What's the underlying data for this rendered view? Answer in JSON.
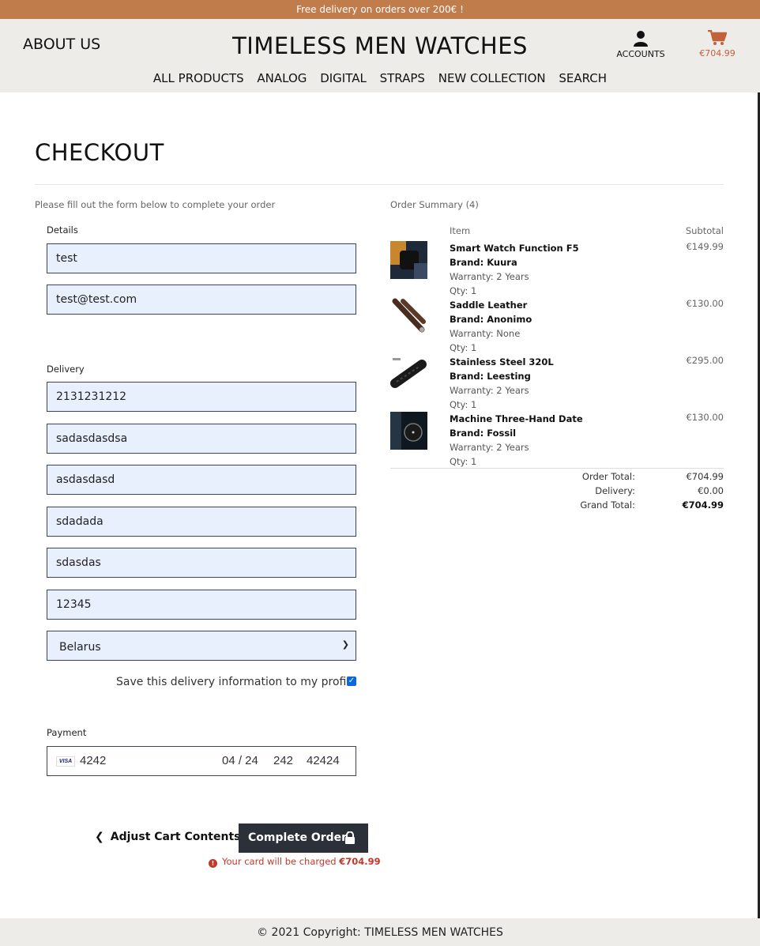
{
  "banner": {
    "text": "Free delivery on orders over 200€ !"
  },
  "header": {
    "about": "ABOUT US",
    "brand": "TIMELESS MEN WATCHES",
    "accounts_label": "ACCOUNTS",
    "cart_total": "€704.99"
  },
  "nav": {
    "items": [
      "ALL PRODUCTS",
      "ANALOG",
      "DIGITAL",
      "STRAPS",
      "NEW COLLECTION",
      "SEARCH"
    ]
  },
  "page": {
    "title": "CHECKOUT"
  },
  "form": {
    "intro": "Please fill out the form below to complete your order",
    "details_label": "Details",
    "full_name": "test",
    "email": "test@test.com",
    "delivery_label": "Delivery",
    "phone": "2131231212",
    "street1": "sadasdasdsa",
    "street2": "asdasdasd",
    "town": "sdadada",
    "county": "sdasdas",
    "postcode": "12345",
    "country": "Belarus",
    "save_info": "Save this delivery information to my profile",
    "save_checked": true,
    "payment_label": "Payment",
    "card": {
      "brand": "VISA",
      "number": "4242",
      "expiry": "04 / 24",
      "cvc": "242",
      "zip": "42424"
    },
    "adjust_label": "Adjust Cart Contents",
    "complete_label": "Complete Order",
    "charge_text": "Your card will be charged",
    "charge_amount": "€704.99"
  },
  "summary": {
    "title": "Order Summary (4)",
    "col_item": "Item",
    "col_subtotal": "Subtotal",
    "items": [
      {
        "name": "Smart Watch Function F5",
        "brand": "Brand: Kuura",
        "warranty": "Warranty: 2 Years",
        "qty": "Qty: 1",
        "price": "€149.99"
      },
      {
        "name": "Saddle Leather",
        "brand": "Brand: Anonimo",
        "warranty": "Warranty: None",
        "qty": "Qty: 1",
        "price": "€130.00"
      },
      {
        "name": "Stainless Steel 320L",
        "brand": "Brand: Leesting",
        "warranty": "Warranty: 2 Years",
        "qty": "Qty: 1",
        "price": "€295.00"
      },
      {
        "name": "Machine Three-Hand Date",
        "brand": "Brand: Fossil",
        "warranty": "Warranty: 2 Years",
        "qty": "Qty: 1",
        "price": "€130.00"
      }
    ],
    "order_total_label": "Order Total:",
    "order_total": "€704.99",
    "delivery_label": "Delivery:",
    "delivery": "€0.00",
    "grand_total_label": "Grand Total:",
    "grand_total": "€704.99"
  },
  "footer": {
    "text": "© 2021 Copyright: TIMELESS MEN WATCHES"
  },
  "colors": {
    "banner": "#c17c4b",
    "header_bg": "#edece8",
    "button": "#2b3039",
    "autofill": "#e8f0fe",
    "alert": "#c0392b"
  }
}
